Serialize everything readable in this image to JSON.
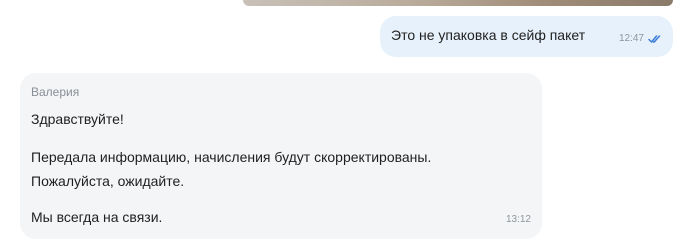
{
  "outgoing": {
    "text": "Это не упаковка в сейф пакет",
    "time": "12:47",
    "status_icon": "double-check-icon",
    "bubble_color": "#e6f1fb",
    "check_color": "#3a7bd5"
  },
  "incoming": {
    "sender": "Валерия",
    "lines": [
      "Здравствуйте!",
      "Передала информацию, начисления будут скорректированы.",
      "Пожалуйста, ожидайте.",
      "Мы всегда на связи."
    ],
    "time": "13:12",
    "bubble_color": "#f3f5f7"
  }
}
